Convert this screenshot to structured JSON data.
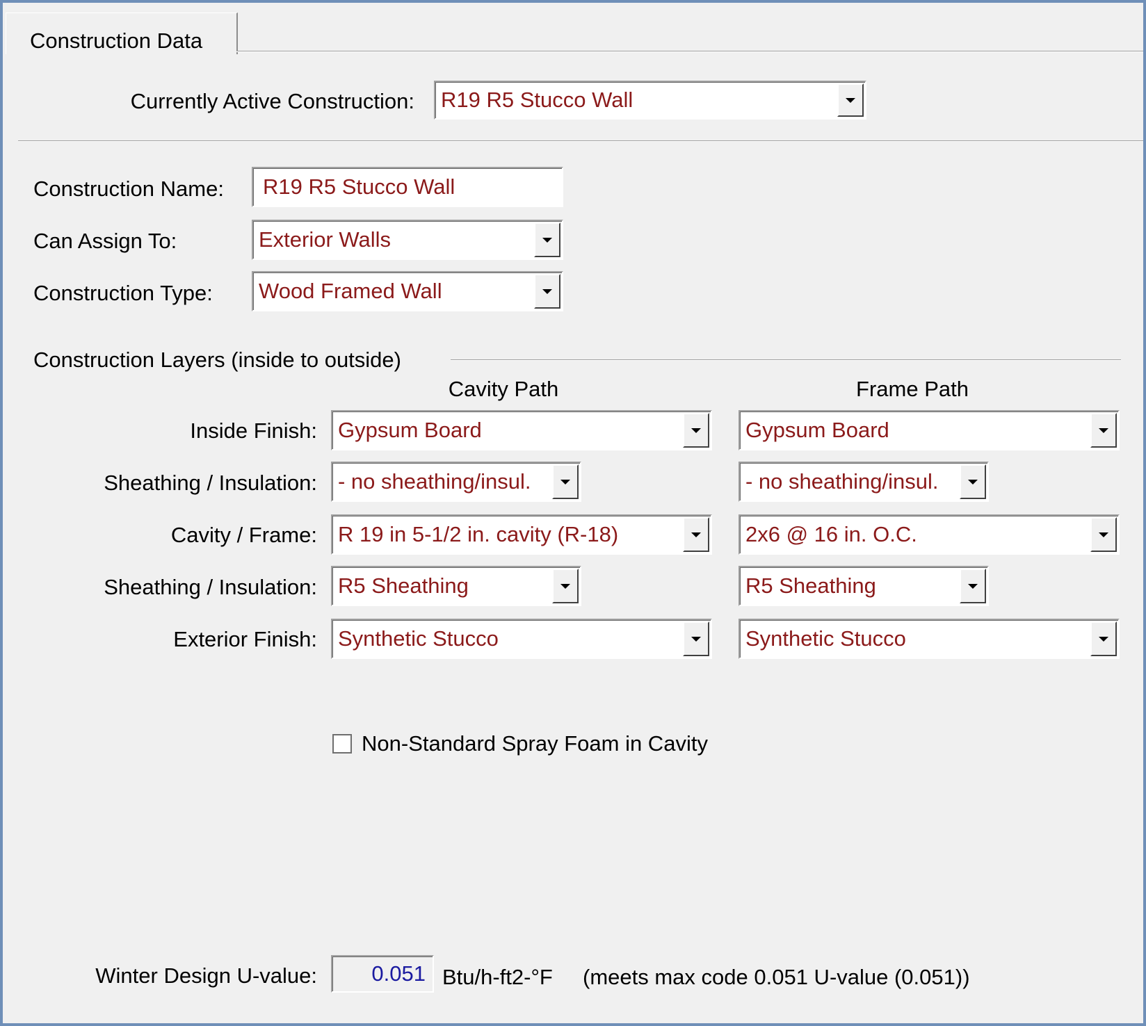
{
  "tab": {
    "label": "Construction Data"
  },
  "active_construction": {
    "label": "Currently Active Construction:",
    "value": "R19 R5 Stucco Wall"
  },
  "construction_name": {
    "label": "Construction Name:",
    "value": "R19 R5 Stucco Wall"
  },
  "can_assign_to": {
    "label": "Can Assign To:",
    "value": "Exterior Walls"
  },
  "construction_type": {
    "label": "Construction Type:",
    "value": "Wood Framed Wall"
  },
  "layers": {
    "section_title": "Construction Layers (inside to outside)",
    "cavity_header": "Cavity Path",
    "frame_header": "Frame Path",
    "rows": [
      {
        "label": "Inside Finish:",
        "cavity": "Gypsum Board",
        "frame": "Gypsum Board"
      },
      {
        "label": "Sheathing / Insulation:",
        "cavity": "- no sheathing/insul.",
        "frame": "- no sheathing/insul."
      },
      {
        "label": "Cavity / Frame:",
        "cavity": "R 19 in 5-1/2 in. cavity (R-18)",
        "frame": "2x6 @ 16 in. O.C."
      },
      {
        "label": "Sheathing / Insulation:",
        "cavity": "R5 Sheathing",
        "frame": "R5 Sheathing"
      },
      {
        "label": "Exterior Finish:",
        "cavity": "Synthetic Stucco",
        "frame": "Synthetic Stucco"
      }
    ]
  },
  "spray_foam": {
    "label": "Non-Standard Spray Foam in Cavity",
    "checked": false
  },
  "u_value": {
    "label": "Winter Design U-value:",
    "value": "0.051",
    "units": "Btu/h-ft2-°F",
    "note": "(meets max code 0.051 U-value (0.051))"
  },
  "colors": {
    "value_text": "#8b1a1a",
    "u_value_text": "#1a1aa0",
    "window_border": "#6f8fb8"
  }
}
